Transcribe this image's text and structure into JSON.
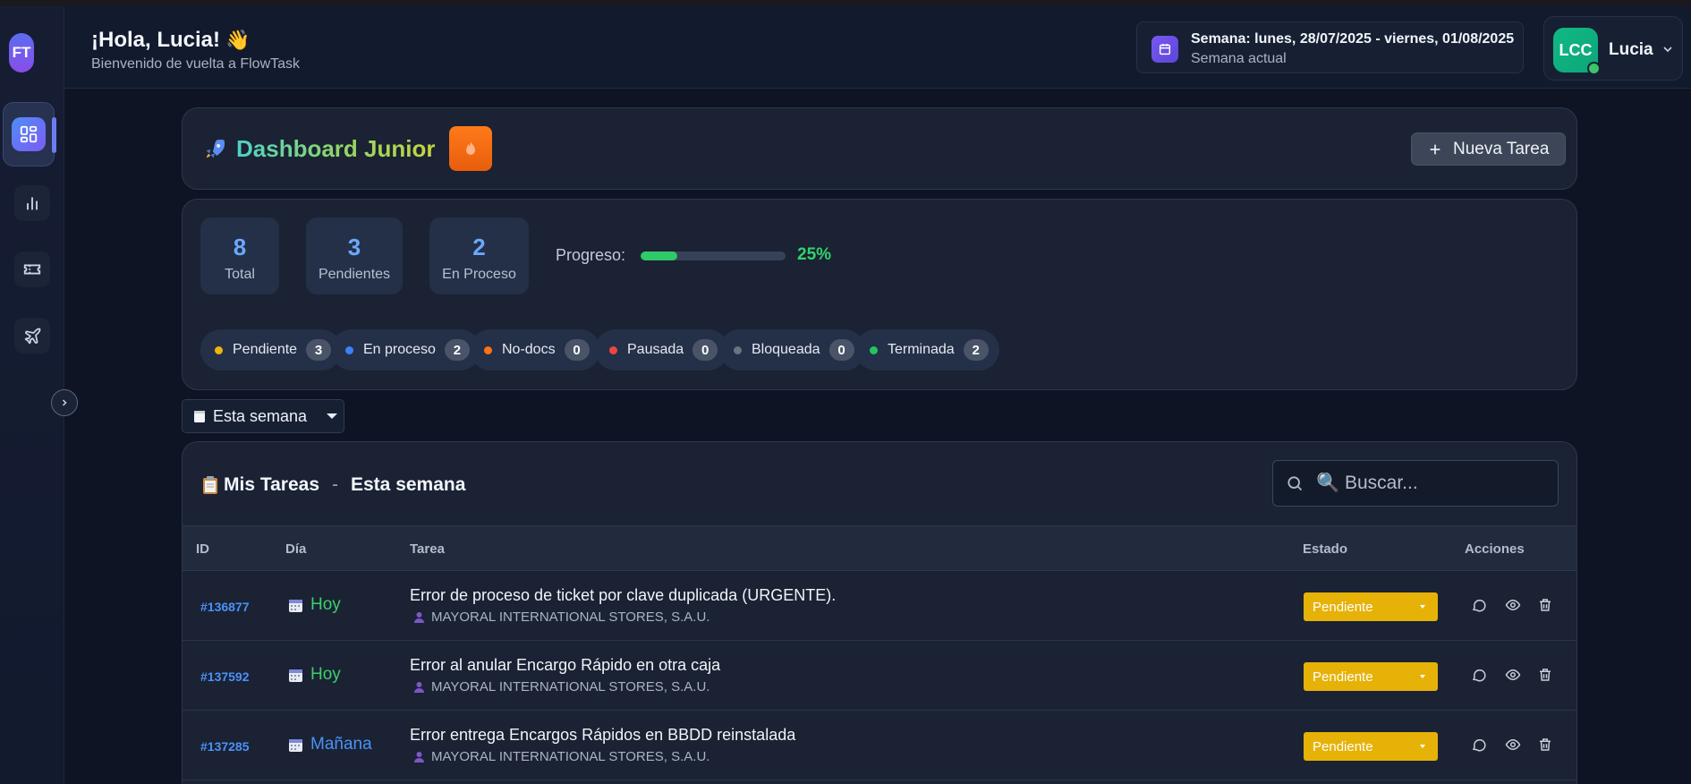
{
  "app": {
    "logo": "FT",
    "greeting": "¡Hola, Lucia!",
    "greeting_emoji": "👋",
    "subtitle": "Bienvenido de vuelta a FlowTask"
  },
  "sidebar": {
    "items": [
      {
        "icon": "dashboard-icon",
        "active": true
      },
      {
        "icon": "bar-chart-icon",
        "active": false
      },
      {
        "icon": "ticket-icon",
        "active": false
      },
      {
        "icon": "plane-icon",
        "active": false
      }
    ],
    "toggle_icon": "chevron-right-icon"
  },
  "week": {
    "title": "Semana: lunes, 28/07/2025 - viernes, 01/08/2025",
    "subtitle": "Semana actual"
  },
  "user": {
    "initials": "LCC",
    "name": "Lucia",
    "status": "online"
  },
  "dashboard": {
    "title": "Dashboard Junior",
    "new_task_label": "Nueva Tarea"
  },
  "stats": [
    {
      "value": "8",
      "label": "Total"
    },
    {
      "value": "3",
      "label": "Pendientes"
    },
    {
      "value": "2",
      "label": "En Proceso"
    }
  ],
  "progress": {
    "label": "Progreso:",
    "percent_text": "25%",
    "fraction": 0.25
  },
  "status_chips": [
    {
      "label": "Pendiente",
      "count": "3",
      "color": "#f0b40c"
    },
    {
      "label": "En proceso",
      "count": "2",
      "color": "#3b82f6"
    },
    {
      "label": "No-docs",
      "count": "0",
      "color": "#f97316"
    },
    {
      "label": "Pausada",
      "count": "0",
      "color": "#ef4444"
    },
    {
      "label": "Bloqueada",
      "count": "0",
      "color": "#6b7280"
    },
    {
      "label": "Terminada",
      "count": "2",
      "color": "#22c55e"
    }
  ],
  "filter": {
    "selected": "Esta semana"
  },
  "tasks": {
    "title": "Mis Tareas",
    "separator": "-",
    "period": "Esta semana",
    "search_placeholder": "🔍 Buscar...",
    "columns": {
      "id": "ID",
      "day": "Día",
      "task": "Tarea",
      "status": "Estado",
      "actions": "Acciones"
    },
    "rows": [
      {
        "id": "#136877",
        "day": "Hoy",
        "day_color": "#3ccf6a",
        "title": "Error de proceso de ticket por clave duplicada (URGENTE).",
        "client": "MAYORAL INTERNATIONAL STORES, S.A.U.",
        "status": "Pendiente"
      },
      {
        "id": "#137592",
        "day": "Hoy",
        "day_color": "#3ccf6a",
        "title": "Error al anular Encargo Rápido en otra caja",
        "client": "MAYORAL INTERNATIONAL STORES, S.A.U.",
        "status": "Pendiente"
      },
      {
        "id": "#137285",
        "day": "Mañana",
        "day_color": "#4c91f7",
        "title": "Error entrega Encargos Rápidos en BBDD reinstalada",
        "client": "MAYORAL INTERNATIONAL STORES, S.A.U.",
        "status": "Pendiente"
      }
    ]
  },
  "colors": {
    "accent": "#4c91f7",
    "status_pending": "#e6b208",
    "progress": "#30c967"
  }
}
